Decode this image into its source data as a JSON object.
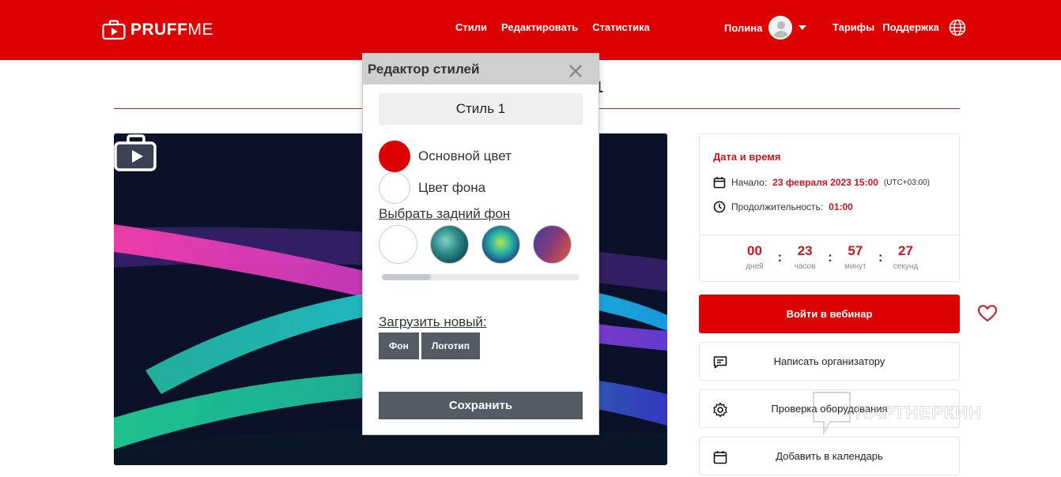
{
  "header": {
    "logo_text_bold": "PRUFF",
    "logo_text_light": "ME",
    "nav": [
      "Стили",
      "Редактировать",
      "Статистика"
    ],
    "user_name": "Полина",
    "right_links": [
      "Тарифы",
      "Поддержка"
    ]
  },
  "page": {
    "title_fragment": "1"
  },
  "info": {
    "title": "Дата и время",
    "start_label": "Начало:",
    "start_value": "23 февраля 2023 15:00",
    "timezone": "(UTC+03:00)",
    "duration_label": "Продолжительность:",
    "duration_value": "01:00",
    "countdown": [
      {
        "value": "00",
        "label": "дней"
      },
      {
        "value": "23",
        "label": "часов"
      },
      {
        "value": "57",
        "label": "минут"
      },
      {
        "value": "27",
        "label": "секунд"
      }
    ]
  },
  "actions": {
    "enter": "Войти в вебинар",
    "write_organizer": "Написать организатору",
    "check_equipment": "Проверка оборудования",
    "add_calendar": "Добавить в календарь"
  },
  "watermark": "ПАРТНЕРКИН",
  "modal": {
    "title": "Редактор стилей",
    "style_name": "Стиль 1",
    "primary_color_label": "Основной цвет",
    "bg_color_label": "Цвет фона",
    "choose_bg_link": "Выбрать задний фон",
    "upload_label": "Загрузить новый:",
    "upload_bg": "Фон",
    "upload_logo": "Логотип",
    "save": "Сохранить",
    "colors": {
      "primary": "#dd0000",
      "background": "#ffffff"
    }
  },
  "theme": {
    "brand_red": "#dd0000",
    "text_red": "#c4161c",
    "dark_button": "#555b65"
  }
}
